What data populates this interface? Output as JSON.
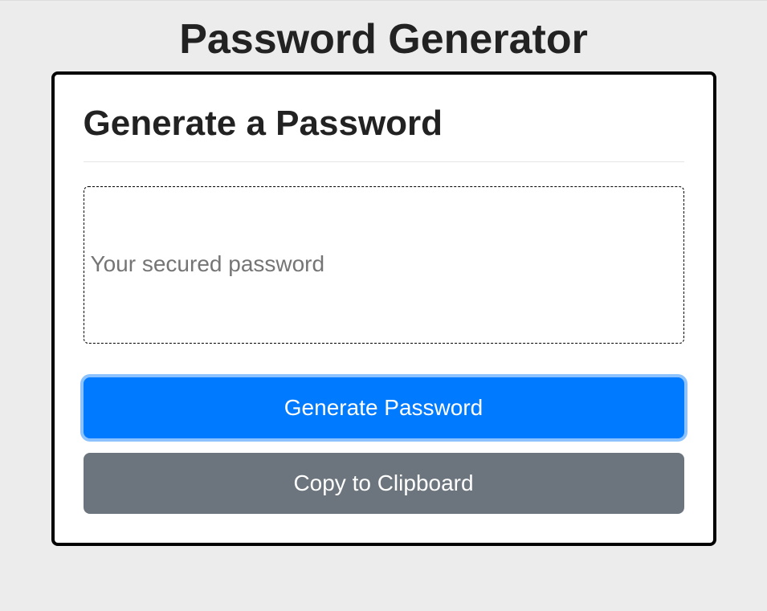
{
  "page": {
    "title": "Password Generator"
  },
  "card": {
    "title": "Generate a Password",
    "password_output": {
      "value": "",
      "placeholder": "Your secured password"
    },
    "buttons": {
      "generate_label": "Generate Password",
      "copy_label": "Copy to Clipboard"
    }
  }
}
